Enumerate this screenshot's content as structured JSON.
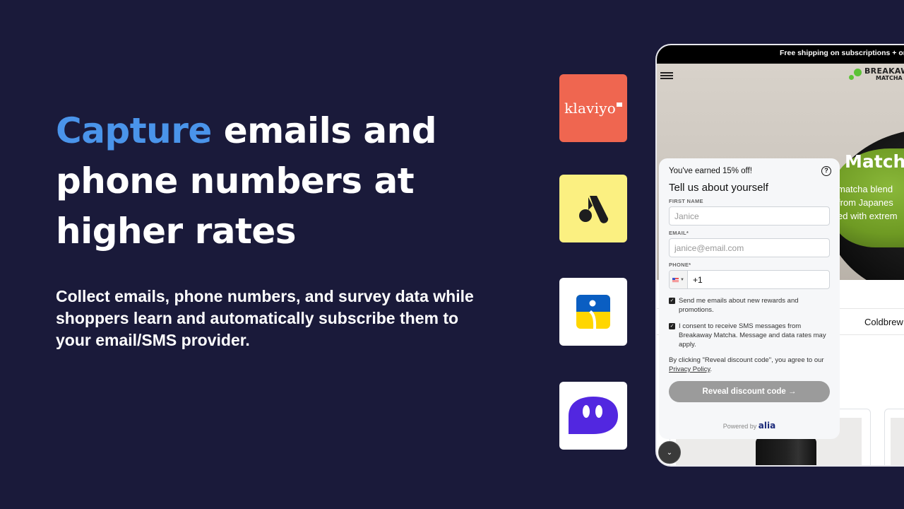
{
  "headline": {
    "accent": "Capture",
    "rest": " emails and phone numbers at higher rates",
    "accent_color": "#4a94ea"
  },
  "subheadline": "Collect emails, phone numbers, and survey data while shoppers learn and automatically subscribe them to your email/SMS provider.",
  "integrations": [
    {
      "name": "Klaviyo",
      "label": "klaviyo",
      "icon": "klaviyo-logo",
      "bg": "#ef6650"
    },
    {
      "name": "Attentive",
      "icon": "attentive-logo",
      "bg": "#fbf081"
    },
    {
      "name": "Postscript",
      "icon": "postscript-logo",
      "bg": "#ffffff"
    },
    {
      "name": "Omnisend-chat",
      "icon": "chat-bubble-logo",
      "bg": "#ffffff"
    }
  ],
  "store": {
    "announcement": "Free shipping on subscriptions + orde",
    "brand_line1": "BREAKAWA",
    "brand_line2": "MATCHA",
    "hero_title": "Matcha",
    "hero_copy": [
      "matcha blend",
      "from Japanes",
      "ed with extrem"
    ],
    "nav_item": "Coldbrew"
  },
  "popup": {
    "earned": "You've earned 15% off!",
    "title": "Tell us about yourself",
    "first_name_label": "FIRST NAME",
    "first_name_placeholder": "Janice",
    "email_label": "EMAIL*",
    "email_placeholder": "janice@email.com",
    "phone_label": "PHONE*",
    "phone_value": "+1",
    "email_opt_in": "Send me emails about new rewards and promotions.",
    "sms_opt_in": "I consent to receive SMS messages from Breakaway Matcha. Message and data rates may apply.",
    "consent_prefix": "By clicking \"Reveal discount code\", you agree to our ",
    "privacy_link": "Privacy Policy",
    "consent_suffix": ".",
    "reveal_button": "Reveal discount code  →",
    "powered_by": "Powered by ",
    "powered_brand": "alia"
  }
}
